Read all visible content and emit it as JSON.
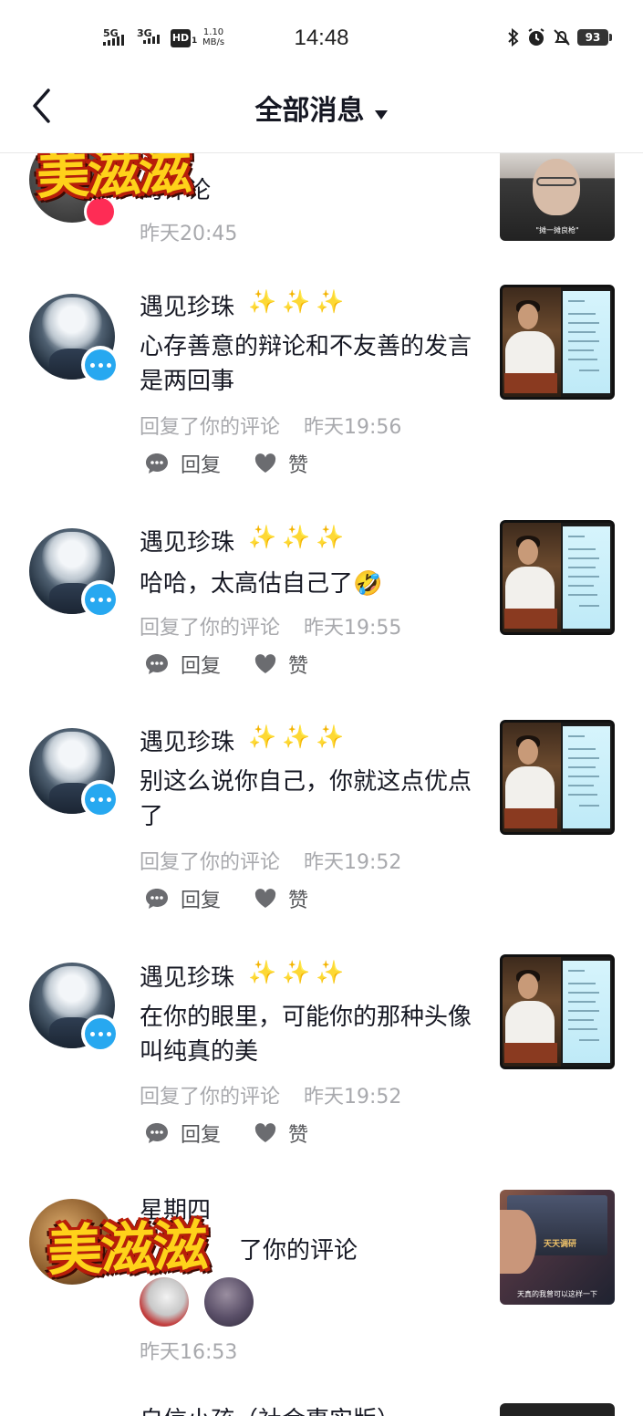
{
  "status_bar": {
    "signal_1": "5G",
    "signal_2": "3G",
    "hd": "HD",
    "hd_sub": "1",
    "speed_value": "1.10",
    "speed_unit": "MB/s",
    "time": "14:48",
    "battery": "93",
    "icons": [
      "bluetooth-icon",
      "alarm-icon",
      "mute-bell-icon",
      "battery-icon"
    ]
  },
  "header": {
    "title": "全部消息",
    "back_icon": "chevron-left-icon",
    "dropdown_icon": "caret-down-icon"
  },
  "sticker_text": "美滋滋",
  "notifications": [
    {
      "name": "",
      "comment": "的评论",
      "time": "昨天20:45",
      "thumb_caption": "\"摊一摊良枪\""
    },
    {
      "name": "遇见珍珠",
      "emoji": "✨✨✨",
      "comment": "心存善意的辩论和不友善的发言是两回事",
      "action_text": "回复了你的评论",
      "time": "昨天19:56",
      "reply_label": "回复",
      "like_label": "赞"
    },
    {
      "name": "遇见珍珠",
      "emoji": "✨✨✨",
      "comment": "哈哈，太高估自己了🤣",
      "action_text": "回复了你的评论",
      "time": "昨天19:55",
      "reply_label": "回复",
      "like_label": "赞"
    },
    {
      "name": "遇见珍珠",
      "emoji": "✨✨✨",
      "comment": "别这么说你自己，你就这点优点了",
      "action_text": "回复了你的评论",
      "time": "昨天19:52",
      "reply_label": "回复",
      "like_label": "赞"
    },
    {
      "name": "遇见珍珠",
      "emoji": "✨✨✨",
      "comment": "在你的眼里，可能你的那种头像叫纯真的美",
      "action_text": "回复了你的评论",
      "time": "昨天19:52",
      "reply_label": "回复",
      "like_label": "赞"
    },
    {
      "name": "星期四",
      "comment": "了你的评论",
      "time": "昨天16:53",
      "thumb_label": "天天调研",
      "thumb_caption": "天真的我曾可以这样一下"
    }
  ],
  "bottom_partial": "自信小孩（社会事实版）"
}
